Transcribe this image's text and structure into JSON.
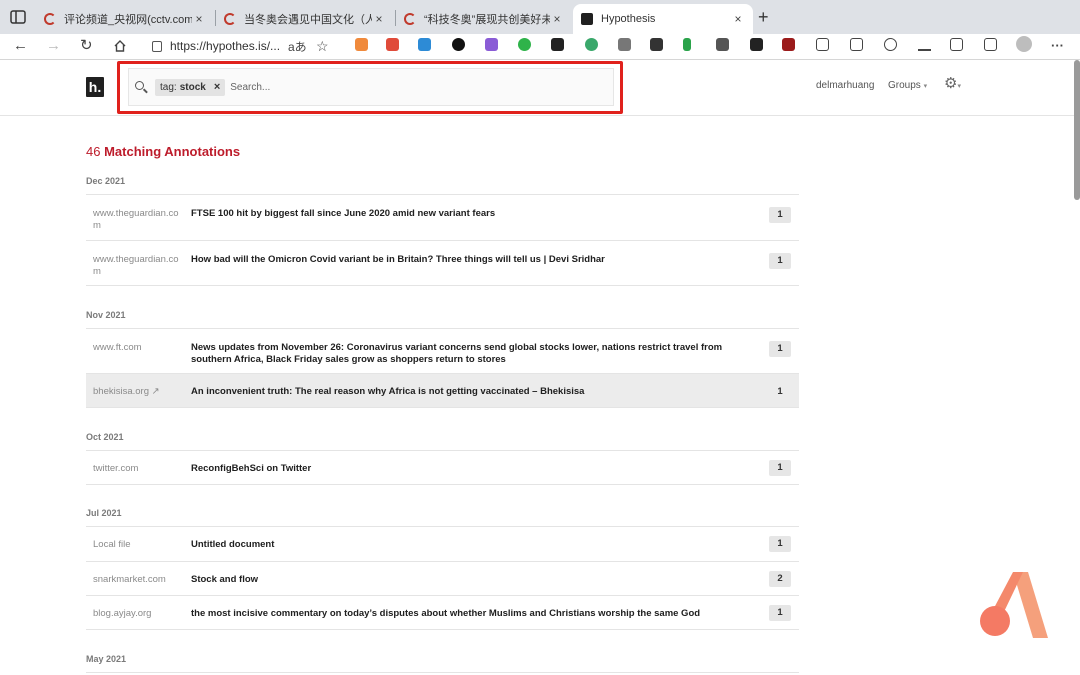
{
  "browser": {
    "tabs": [
      {
        "title": "评论频道_央视网(cctv.com)",
        "close": "×",
        "favicon_color": "#c0392b"
      },
      {
        "title": "当冬奥会遇见中国文化（人民时",
        "close": "×",
        "favicon_color": "#c0392b"
      },
      {
        "title": "“科技冬奥”展现共创美好未来的",
        "close": "×",
        "favicon_color": "#c0392b"
      },
      {
        "title": "Hypothesis",
        "close": "×",
        "favicon_color": "#202020"
      }
    ],
    "new_tab": "+",
    "url": "https://hypothes.is/...",
    "more": "···"
  },
  "header": {
    "logo": "h.",
    "search": {
      "tag_prefix": "tag:",
      "tag_value": "stock",
      "tag_remove": "×",
      "placeholder": "Search..."
    },
    "username": "delmarhuang",
    "groups_label": "Groups",
    "colors": {
      "highlight": "#e0211c"
    }
  },
  "results": {
    "count": "46",
    "label": "Matching Annotations",
    "accent": "#bd1c2b",
    "months": [
      {
        "label": "Dec 2021",
        "items": [
          {
            "domain": "www.theguardian.com",
            "title": "FTSE 100 hit by biggest fall since June 2020 amid new variant fears",
            "count": "1"
          },
          {
            "domain": "www.theguardian.com",
            "title": "How bad will the Omicron Covid variant be in Britain? Three things will tell us | Devi Sridhar",
            "count": "1"
          }
        ]
      },
      {
        "label": "Nov 2021",
        "items": [
          {
            "domain": "www.ft.com",
            "title": "News updates from November 26: Coronavirus variant concerns send global stocks lower, nations restrict travel from southern Africa, Black Friday sales grow as shoppers return to stores",
            "count": "1"
          },
          {
            "domain": "bhekisisa.org ↗",
            "title": "An inconvenient truth: The real reason why Africa is not getting vaccinated – Bhekisisa",
            "count": "1"
          }
        ]
      },
      {
        "label": "Oct 2021",
        "items": [
          {
            "domain": "twitter.com",
            "title": "ReconfigBehSci on Twitter",
            "count": "1"
          }
        ]
      },
      {
        "label": "Jul 2021",
        "items": [
          {
            "domain": "Local file",
            "title": "Untitled document",
            "count": "1"
          },
          {
            "domain": "snarkmarket.com",
            "title": "Stock and flow",
            "count": "2"
          },
          {
            "domain": "blog.ayjay.org",
            "title": "the most incisive commentary on today’s disputes about whether Muslims and Christians worship the same God",
            "count": "1"
          }
        ]
      },
      {
        "label": "May 2021",
        "items": []
      }
    ]
  }
}
